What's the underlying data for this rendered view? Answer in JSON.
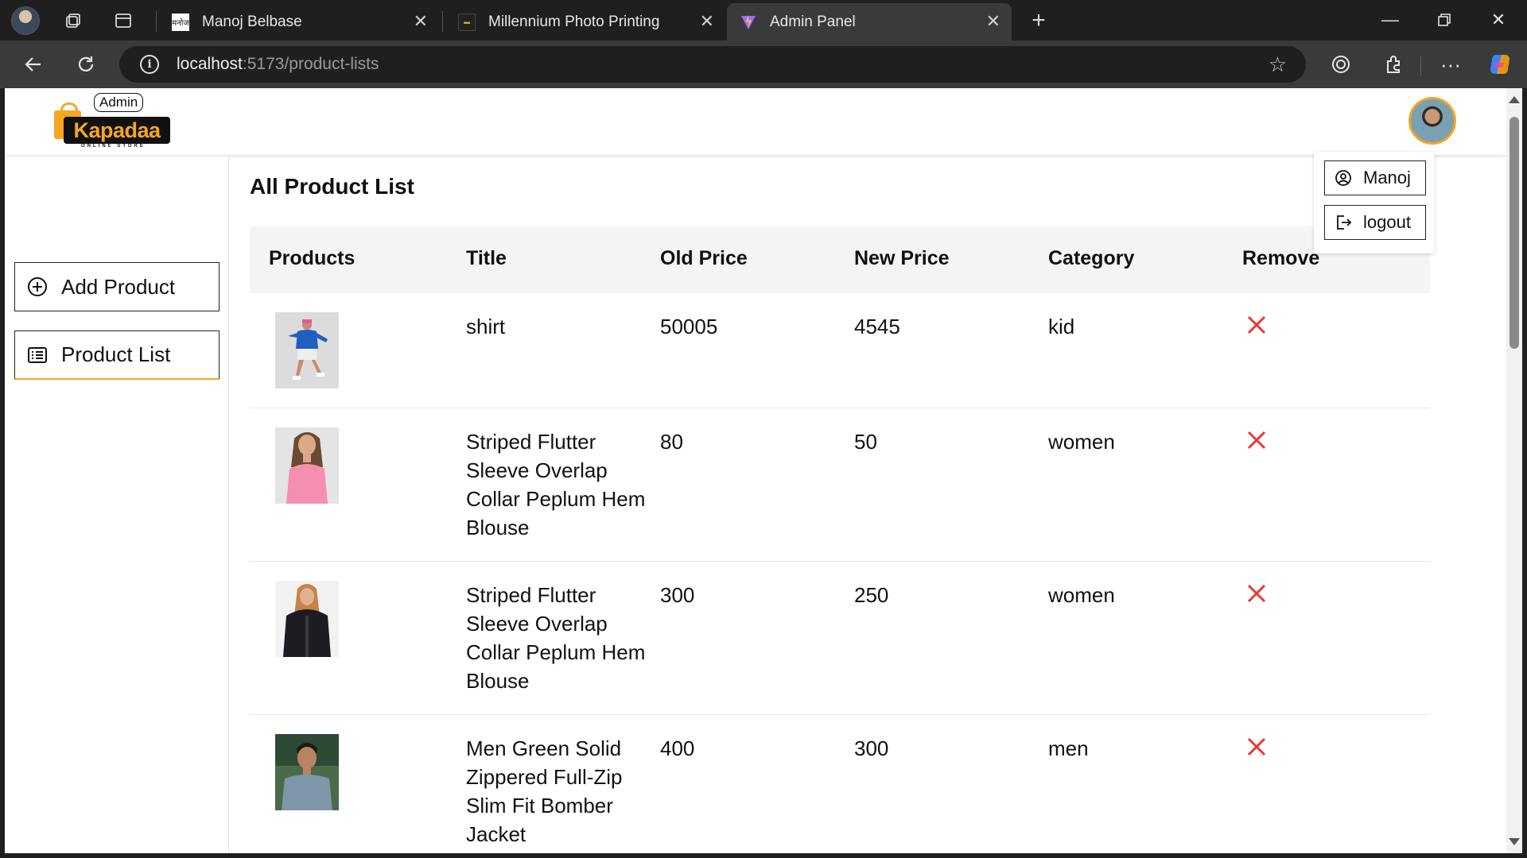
{
  "browser": {
    "tabs": [
      {
        "title": "Manoj Belbase",
        "favicon_text": "मनोज"
      },
      {
        "title": "Millennium Photo Printing",
        "favicon_text": ""
      },
      {
        "title": "Admin Panel",
        "favicon_text": ""
      }
    ],
    "url_host": "localhost",
    "url_path": ":5173/product-lists"
  },
  "header": {
    "logo_badge": "Admin",
    "logo_wordmark": "Kapadaa",
    "logo_tagline": "ONLINE STORE"
  },
  "dropdown": {
    "user_label": "Manoj",
    "logout_label": "logout"
  },
  "sidebar": {
    "items": [
      {
        "label": "Add Product",
        "icon": "plus-circle-icon"
      },
      {
        "label": "Product List",
        "icon": "list-icon"
      }
    ]
  },
  "main": {
    "title": "All Product List",
    "columns": [
      "Products",
      "Title",
      "Old Price",
      "New Price",
      "Category",
      "Remove"
    ],
    "rows": [
      {
        "title": "shirt",
        "old_price": "50005",
        "new_price": "4545",
        "category": "kid",
        "image": "kid-shirt-photo"
      },
      {
        "title": "Striped Flutter Sleeve Overlap Collar Peplum Hem Blouse",
        "old_price": "80",
        "new_price": "50",
        "category": "women",
        "image": "women-pink-top-photo"
      },
      {
        "title": "Striped Flutter Sleeve Overlap Collar Peplum Hem Blouse",
        "old_price": "300",
        "new_price": "250",
        "category": "women",
        "image": "women-black-jacket-photo"
      },
      {
        "title": "Men Green Solid Zippered Full-Zip Slim Fit Bomber Jacket",
        "old_price": "400",
        "new_price": "300",
        "category": "men",
        "image": "men-grey-shirt-photo"
      }
    ]
  },
  "colors": {
    "accent": "#f5a623",
    "remove": "#e53935",
    "header_bg": "#f3f4f6"
  }
}
